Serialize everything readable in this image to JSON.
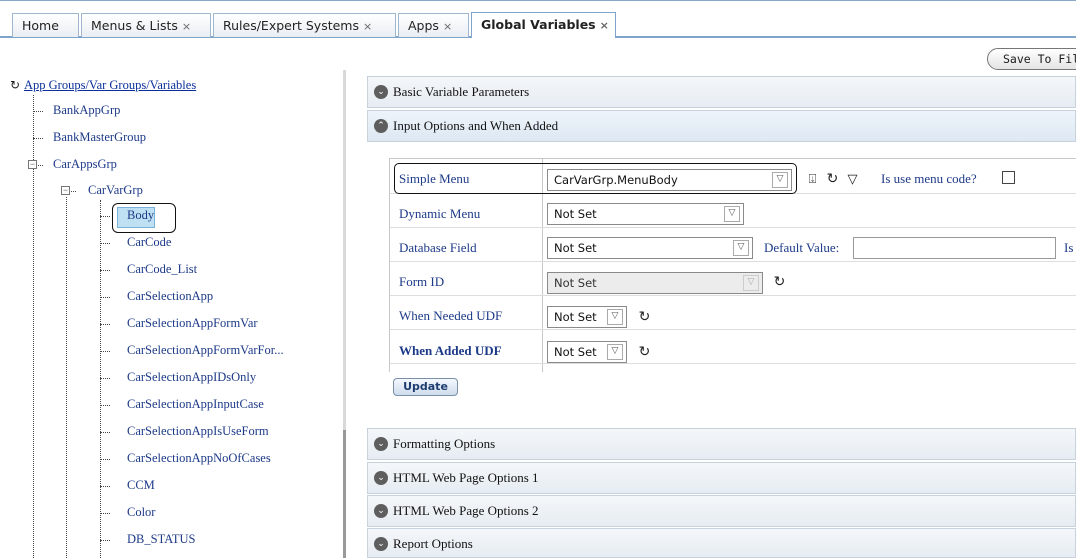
{
  "tabs": [
    {
      "label": "Home",
      "closable": false,
      "active": false
    },
    {
      "label": "Menus & Lists",
      "closable": true,
      "active": false
    },
    {
      "label": "Rules/Expert Systems",
      "closable": true,
      "active": false
    },
    {
      "label": "Apps",
      "closable": true,
      "active": false
    },
    {
      "label": "Global Variables",
      "closable": true,
      "active": true
    }
  ],
  "close_glyph": "×",
  "toolbar": {
    "save_label": "Save To File"
  },
  "tree": {
    "root_label": "App Groups/Var Groups/Variables",
    "groups": [
      "BankAppGrp",
      "BankMasterGroup",
      "CarAppsGrp"
    ],
    "subgroup": "CarVarGrp",
    "selected": "Body",
    "variables": [
      "Body",
      "CarCode",
      "CarCode_List",
      "CarSelectionApp",
      "CarSelectionAppFormVar",
      "CarSelectionAppFormVarFor...",
      "CarSelectionAppIDsOnly",
      "CarSelectionAppInputCase",
      "CarSelectionAppIsUseForm",
      "CarSelectionAppNoOfCases",
      "CCM",
      "Color",
      "DB_STATUS"
    ]
  },
  "sections": {
    "basic": "Basic Variable Parameters",
    "input": "Input Options and When Added",
    "formatting": "Formatting Options",
    "html1": "HTML Web Page Options 1",
    "html2": "HTML Web Page Options 2",
    "report": "Report Options"
  },
  "form": {
    "simple_menu_label": "Simple Menu",
    "simple_menu_value": "CarVarGrp.MenuBody",
    "use_menu_code_label": "Is use menu code?",
    "use_menu_code_checked": false,
    "dynamic_menu_label": "Dynamic Menu",
    "dynamic_menu_value": "Not Set",
    "database_field_label": "Database Field",
    "database_field_value": "Not Set",
    "default_value_label": "Default Value:",
    "default_value": "",
    "cut_label": "Is",
    "form_id_label": "Form ID",
    "form_id_value": "Not Set",
    "when_needed_label": "When Needed UDF",
    "when_needed_value": "Not Set",
    "when_added_label": "When Added UDF",
    "when_added_value": "Not Set",
    "update_label": "Update"
  },
  "icons": {
    "collapsed": "chevron-down-circle-icon",
    "expanded": "chevron-up-circle-icon",
    "refresh": "refresh-icon",
    "import": "import-icon",
    "filter": "filter-icon",
    "dropdown": "dropdown-arrow-icon"
  }
}
